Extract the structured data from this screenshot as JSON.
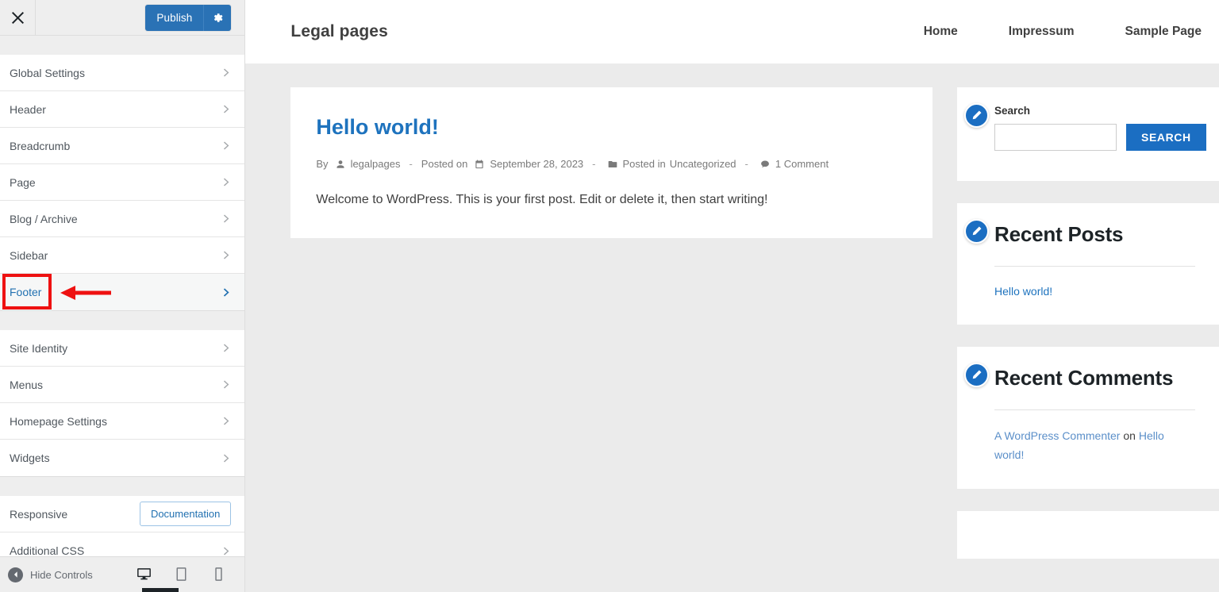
{
  "customizer": {
    "close_label": "Close customizer",
    "publish_label": "Publish",
    "gear_label": "Publish settings",
    "panel_groups": [
      {
        "items": [
          {
            "label": "Global Settings"
          },
          {
            "label": "Header"
          },
          {
            "label": "Breadcrumb"
          },
          {
            "label": "Page"
          },
          {
            "label": "Blog / Archive"
          },
          {
            "label": "Sidebar"
          },
          {
            "label": "Footer",
            "highlighted": true
          }
        ]
      },
      {
        "items": [
          {
            "label": "Site Identity"
          },
          {
            "label": "Menus"
          },
          {
            "label": "Homepage Settings"
          },
          {
            "label": "Widgets"
          }
        ]
      }
    ],
    "responsive": {
      "label": "Responsive",
      "button_label": "Documentation"
    },
    "additional_css": {
      "label": "Additional CSS"
    },
    "footer": {
      "hide_controls_label": "Hide Controls",
      "devices": [
        {
          "name": "desktop",
          "label": "Enter desktop preview mode",
          "active": true
        },
        {
          "name": "tablet",
          "label": "Enter tablet preview mode",
          "active": false
        },
        {
          "name": "mobile",
          "label": "Enter mobile preview mode",
          "active": false
        }
      ]
    }
  },
  "preview": {
    "site_title": "Legal pages",
    "nav": [
      {
        "label": "Home"
      },
      {
        "label": "Impressum"
      },
      {
        "label": "Sample Page"
      }
    ],
    "post": {
      "title": "Hello world!",
      "by_label": "By",
      "author": "legalpages",
      "posted_on_label": "Posted on",
      "date": "September 28, 2023",
      "posted_in_label": "Posted in",
      "category": "Uncategorized",
      "comments": "1 Comment",
      "separator": "-",
      "excerpt": "Welcome to WordPress. This is your first post. Edit or delete it, then start writing!"
    },
    "widgets": {
      "search": {
        "title": "Search",
        "input_value": "",
        "input_placeholder": "",
        "button_label": "SEARCH"
      },
      "recent_posts": {
        "title": "Recent Posts",
        "items": [
          {
            "label": "Hello world!"
          }
        ]
      },
      "recent_comments": {
        "title": "Recent Comments",
        "author": "A WordPress Commenter",
        "on_label": "on",
        "post": "Hello world!"
      }
    }
  },
  "annotation": {
    "highlight_target": "Footer",
    "color": "#ee1111"
  }
}
